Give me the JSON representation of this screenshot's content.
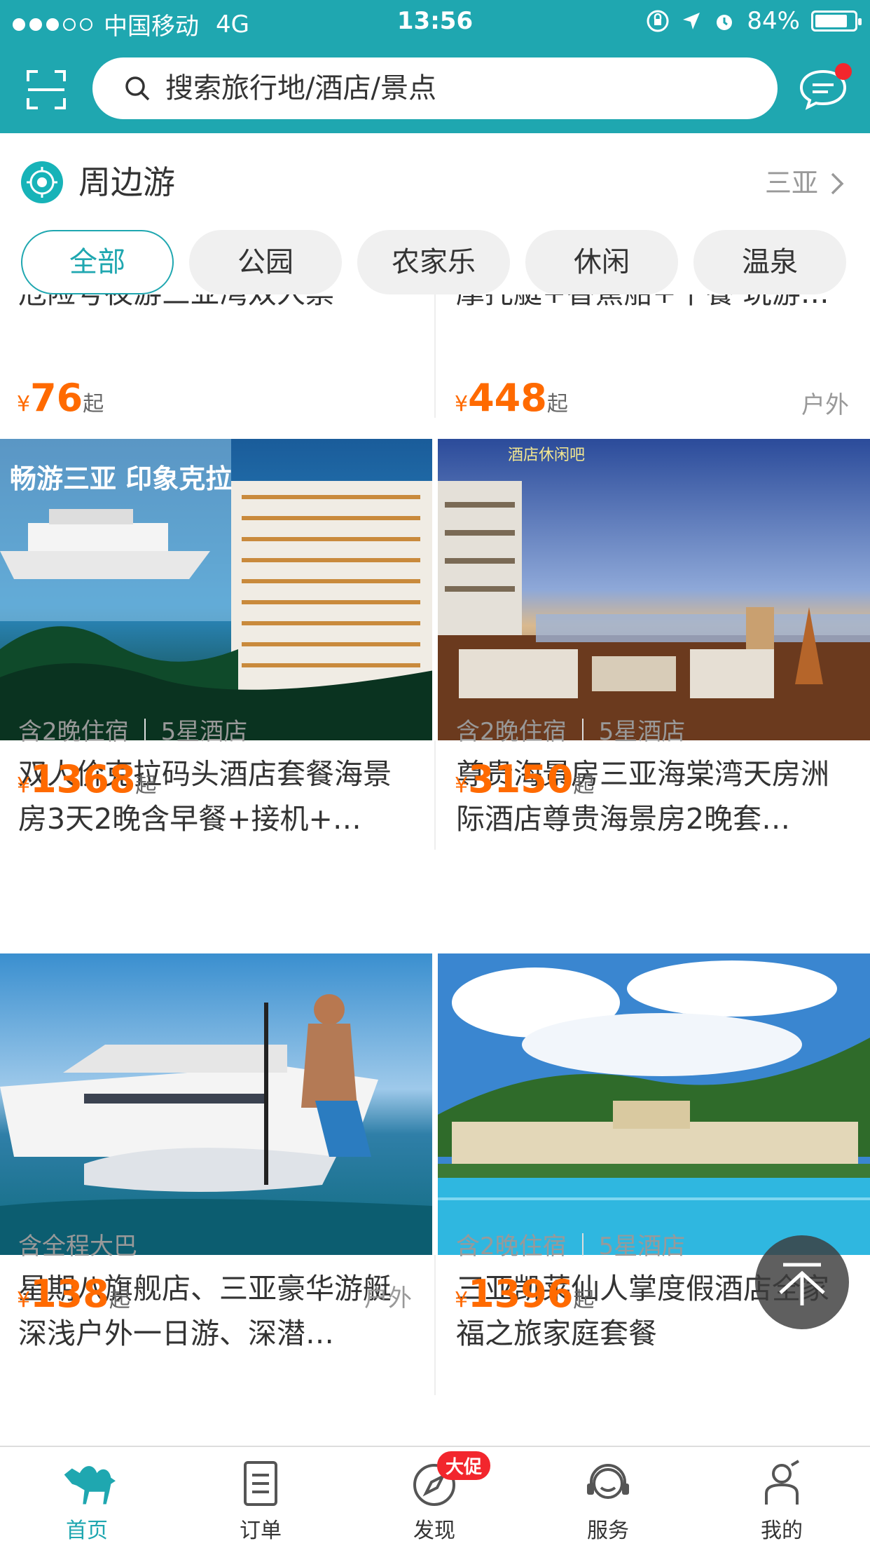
{
  "status_bar": {
    "carrier": "中国移动",
    "network": "4G",
    "time": "13:56",
    "battery_text": "84%",
    "battery_level": 0.84
  },
  "header": {
    "search_placeholder": "搜索旅行地/酒店/景点"
  },
  "section": {
    "title": "周边游",
    "city": "三亚"
  },
  "categories": [
    "全部",
    "公园",
    "农家乐",
    "休闲",
    "温泉"
  ],
  "partial_row": {
    "left": {
      "title": "危险号夜游三亚湾双人票",
      "price": "76",
      "unit": "起",
      "currency": "¥"
    },
    "right": {
      "title": "摩托艇+香蕉船+午餐 玩游…",
      "price": "448",
      "unit": "起",
      "currency": "¥",
      "tag": "户外"
    }
  },
  "cards": [
    {
      "title": "双人价克拉码头酒店套餐海景房3天2晚含早餐+接机+…",
      "meta": [
        "含2晚住宿",
        "5星酒店"
      ],
      "price": "1368",
      "unit": "起",
      "currency": "¥",
      "image_text": "畅游三亚 印象克拉"
    },
    {
      "title": "尊贵海景房三亚海棠湾天房洲际酒店尊贵海景房2晚套…",
      "meta": [
        "含2晚住宿",
        "5星酒店"
      ],
      "price": "3150",
      "unit": "起",
      "currency": "¥",
      "image_text": "酒店休闲吧"
    },
    {
      "title": "星期八旗舰店、三亚豪华游艇深浅户外一日游、深潜…",
      "meta": [
        "含全程大巴"
      ],
      "price": "138",
      "unit": "起",
      "currency": "¥",
      "tag": "户外"
    },
    {
      "title": "三亚凯莱仙人掌度假酒店全家福之旅家庭套餐",
      "meta": [
        "含2晚住宿",
        "5星酒店"
      ],
      "price": "1396",
      "unit": "起",
      "currency": "¥"
    }
  ],
  "tabbar": [
    {
      "label": "首页",
      "icon": "camel-icon"
    },
    {
      "label": "订单",
      "icon": "order-icon"
    },
    {
      "label": "发现",
      "icon": "compass-icon",
      "badge": "大促"
    },
    {
      "label": "服务",
      "icon": "headset-icon"
    },
    {
      "label": "我的",
      "icon": "user-icon"
    }
  ],
  "colors": {
    "brand": "#1fa7b0",
    "price": "#ff6a00",
    "badge": "#f2262d"
  }
}
